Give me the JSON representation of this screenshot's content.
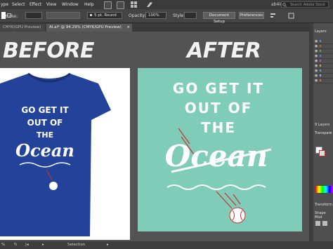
{
  "menubar": {
    "items": [
      "ype",
      "Select",
      "Effect",
      "View",
      "Window",
      "Help"
    ],
    "user": "ab4iu",
    "search_placeholder": "Search Adobe Stock"
  },
  "controlbar": {
    "stroke_label": "Stroke:",
    "brush_value": "5 pt. Round",
    "opacity_label": "Opacity:",
    "opacity_value": "100%",
    "style_label": "Style:",
    "document_setup": "Document Setup",
    "preferences": "Preferences"
  },
  "tabs": [
    {
      "label": "CMYK/GPU Preview)"
    },
    {
      "label": "AI.ai* @ 94.29% (CMYK/GPU Preview)"
    }
  ],
  "canvas": {
    "before_label": "BEFORE",
    "after_label": "AFTER",
    "design_line1": "GO GET IT",
    "design_line2": "OUT OF",
    "design_line3": "THE",
    "design_script": "Ocean",
    "shirt_color": "#23439a",
    "after_bg": "#7fcdb8",
    "accent_red": "#c8322e"
  },
  "statusbar": {
    "zoom": "%",
    "tool": "Selection"
  },
  "panels": {
    "layers_title": "Layers",
    "layers_count": "9 Layers",
    "layer_colors": [
      "#5b8cf0",
      "#e04848",
      "#46b646",
      "#4e7cf0",
      "#c050c0",
      "#e0a030",
      "#40b0c0",
      "#a0a0ff",
      "#e06060"
    ],
    "transparency_title": "Transpare",
    "transform_title": "Transform",
    "shape_title": "Shape Mod"
  }
}
